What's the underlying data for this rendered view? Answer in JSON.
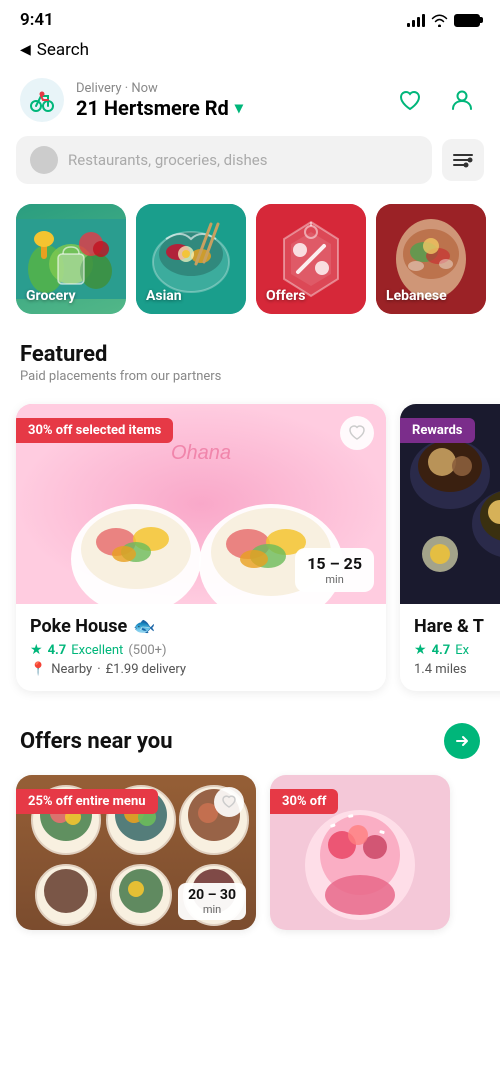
{
  "statusBar": {
    "time": "9:41",
    "wifi": "wifi",
    "battery": "battery"
  },
  "nav": {
    "backLabel": "Search"
  },
  "address": {
    "deliveryMode": "Delivery · Now",
    "street": "21 Hertsmere Rd"
  },
  "search": {
    "placeholder": "Restaurants, groceries, dishes"
  },
  "categories": [
    {
      "id": "grocery",
      "label": "Grocery",
      "color": "#2a9d8f"
    },
    {
      "id": "asian",
      "label": "Asian",
      "color": "#1a9e8c"
    },
    {
      "id": "offers",
      "label": "Offers",
      "color": "#e63946"
    },
    {
      "id": "lebanese",
      "label": "Lebanese",
      "color": "#9b2226"
    }
  ],
  "featured": {
    "title": "Featured",
    "subtitle": "Paid placements from our partners"
  },
  "restaurants": [
    {
      "name": "Poke House",
      "emoji": "🐟",
      "badge": "30% off selected items",
      "badgeColor": "#e63946",
      "ratingScore": "4.7",
      "ratingLabel": "Excellent",
      "ratingCount": "(500+)",
      "nearby": "Nearby",
      "delivery": "£1.99 delivery",
      "timeMin": "15 – 25",
      "timeUnit": "min"
    },
    {
      "name": "Hare & T",
      "emoji": "",
      "badge": "Rewards",
      "badgeColor": "#7b2d8b",
      "ratingScore": "4.7",
      "ratingLabel": "Ex",
      "ratingCount": "",
      "nearby": "1.4 miles",
      "delivery": "",
      "timeMin": "",
      "timeUnit": ""
    }
  ],
  "offersSection": {
    "title": "Offers near you"
  },
  "offerCards": [
    {
      "badge": "25% off entire menu",
      "timeMin": "20 – 30",
      "timeUnit": "min"
    },
    {
      "badge": "30% off",
      "timeMin": "",
      "timeUnit": ""
    }
  ],
  "icons": {
    "heart": "♡",
    "heartFilled": "♥",
    "person": "👤",
    "pin": "📍",
    "star": "★",
    "chevronDown": "▾",
    "arrowRight": "→",
    "backArrow": "◀",
    "filter": "⚙"
  }
}
